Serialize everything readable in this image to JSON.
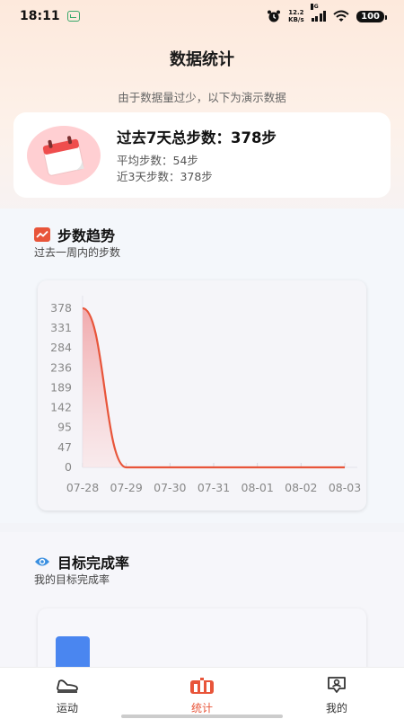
{
  "status_bar": {
    "time": "18:11",
    "net_speed_value": "12.2",
    "net_speed_unit": "KB/s",
    "network_type": "5G",
    "battery": "100"
  },
  "header": {
    "title": "数据统计",
    "notice": "由于数据量过少，以下为演示数据"
  },
  "summary": {
    "title": "过去7天总步数：378步",
    "average": "平均步数：54步",
    "recent3": "近3天步数：378步"
  },
  "trend": {
    "title": "步数趋势",
    "subtitle": "过去一周内的步数"
  },
  "goal": {
    "title": "目标完成率",
    "subtitle": "我的目标完成率",
    "bar_color": "#4a86f0"
  },
  "chart_data": {
    "type": "area",
    "categories": [
      "07-28",
      "07-29",
      "07-30",
      "07-31",
      "08-01",
      "08-02",
      "08-03"
    ],
    "values": [
      378,
      0,
      0,
      0,
      0,
      0,
      0
    ],
    "yticks": [
      0,
      47,
      95,
      142,
      189,
      236,
      284,
      331,
      378
    ],
    "ylim": [
      0,
      378
    ],
    "grid": false,
    "line_color": "#e8553a",
    "fill_color": "#f3b3b5"
  },
  "tabs": [
    {
      "label": "运动",
      "icon": "sneaker-icon",
      "active": false
    },
    {
      "label": "统计",
      "icon": "stats-icon",
      "active": true
    },
    {
      "label": "我的",
      "icon": "profile-icon",
      "active": false
    }
  ],
  "colors": {
    "accent": "#e8553a",
    "goal_icon": "#3a8fe0"
  }
}
